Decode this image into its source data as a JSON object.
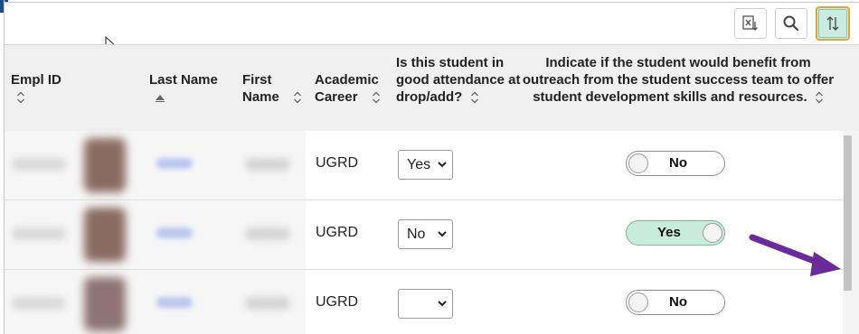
{
  "toolbar": {
    "buttons": [
      {
        "icon": "excel-export-icon"
      },
      {
        "icon": "search-icon"
      },
      {
        "icon": "sort-icon",
        "highlighted": true
      }
    ]
  },
  "table": {
    "columns": [
      {
        "label": "Empl ID",
        "sortable": true
      },
      {
        "label": "Last Name",
        "sortable": true,
        "sort": "ascending"
      },
      {
        "label": "First Name",
        "sortable": true
      },
      {
        "label": "Academic Career",
        "sortable": true
      },
      {
        "label": "Is this student in good attendance at drop/add?",
        "sortable": true
      },
      {
        "label": "Indicate if the student would benefit from outreach from the student success team to offer student development skills and resources.",
        "sortable": true
      }
    ],
    "rows": [
      {
        "career": "UGRD",
        "attendance": "Yes",
        "outreach": "No"
      },
      {
        "career": "UGRD",
        "attendance": "No",
        "outreach": "Yes"
      },
      {
        "career": "UGRD",
        "attendance": "",
        "outreach": "No"
      }
    ]
  },
  "colors": {
    "header_bg": "#f0f0f0",
    "toggle_on_bg": "#c7ebdc",
    "highlight_border": "#e8a33c",
    "annotation_arrow": "#6a2a9a"
  }
}
